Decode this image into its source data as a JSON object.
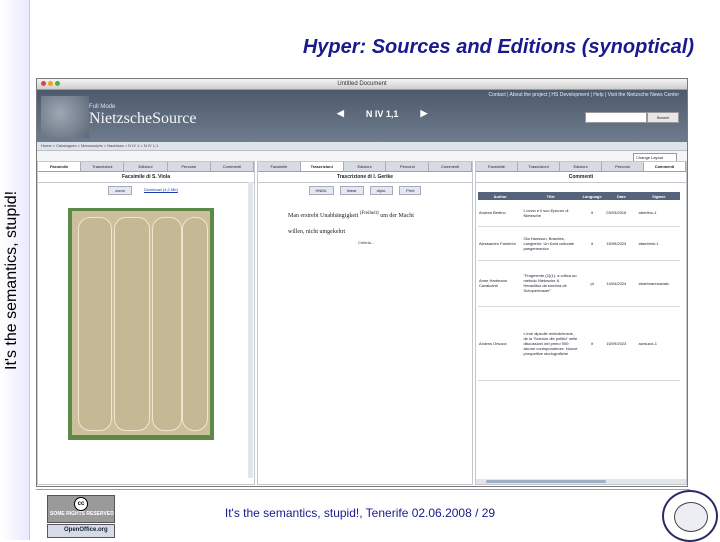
{
  "slide": {
    "side_text": "It's the semantics, stupid!",
    "title": "Hyper: Sources and Editions (synoptical)",
    "footer": "It's the semantics, stupid!, Tenerife 02.06.2008 / 29",
    "badges": {
      "cc": "cc",
      "cc_text": "SOME RIGHTS RESERVED",
      "oo": "OpenOffice.org"
    }
  },
  "browser": {
    "window_title": "Untitled Document",
    "colors": {
      "close": "#e0443e",
      "min": "#e5a627",
      "max": "#52b043"
    }
  },
  "site": {
    "top_nav": "Contact | About the project | HS Development | Help | Visit the Nietzsche News Center",
    "logo_small": "Full Mode",
    "logo_big": "NietzscheSource",
    "page_label": "N IV 1,1",
    "prev_icon": "◀",
    "next_icon": "▶",
    "search_label": "Search",
    "breadcrumb": "Home > Catalogues > Manuscripts > Nachlass > N IV 1 > N IV 1,1",
    "layout_label": "Change Layout"
  },
  "panes": {
    "facsimile": {
      "tabs": [
        "Facsimile",
        "Trascrizioni",
        "Edizioni",
        "Percorsi",
        "Commenti"
      ],
      "active_tab": 0,
      "heading": "Facsimile di S. Viola",
      "zoom_value": "zoom",
      "download_label": "Download (4,2 Mb)"
    },
    "transcription": {
      "tabs": [
        "Facsimile",
        "Trascrizioni",
        "Edizioni",
        "Percorsi",
        "Commenti"
      ],
      "active_tab": 1,
      "heading": "Trascrizione di I. Gerike",
      "buttons": [
        "HNML",
        "linear",
        "diplo.",
        "Print"
      ],
      "text_line1": "Man erstrebt Unabhängigkeit",
      "text_insert": "(Freiheit)",
      "text_line1_end": "um der Macht",
      "text_line2": "willen, nicht umgekehrt",
      "criteria_link": "Criteria..."
    },
    "comments": {
      "tabs": [
        "Facsimile",
        "Trascrizioni",
        "Edizioni",
        "Percorsi",
        "Commenti"
      ],
      "active_tab": 4,
      "heading": "Commenti",
      "columns": [
        "Author",
        "Title",
        "Language",
        "Date",
        "Sigiare"
      ],
      "rows": [
        [
          "Andrea Bertino",
          "L'ovvio e il suo Epicuro di Nietzsche",
          "it",
          "03/03/2016",
          "abertino-1"
        ],
        [
          "Alessandro Fambrini",
          "Ola Hansson, Brandes, Langbehn: Un Kant culturale pangermanico",
          "it",
          "15/09/2023",
          "afambrini-1"
        ],
        [
          "Anne Hartmann Cavalcanti",
          "\"Fragmente (2)(1): a critica ao método Nietzsche & Heraclitus da sombra de Schopenhauer\"",
          "pt",
          "14/04/2024",
          "ahartmanncavalc"
        ],
        [
          "Andrea Orsucci",
          "L'ene dipsolle metodchnsne, de la 'Scienze dle politici' nelle discussioni del primo 900: alcune corrispondenze. Nuove prospettive storiografiche",
          "it",
          "15/09/2023",
          "aorsucci-1"
        ]
      ]
    }
  }
}
